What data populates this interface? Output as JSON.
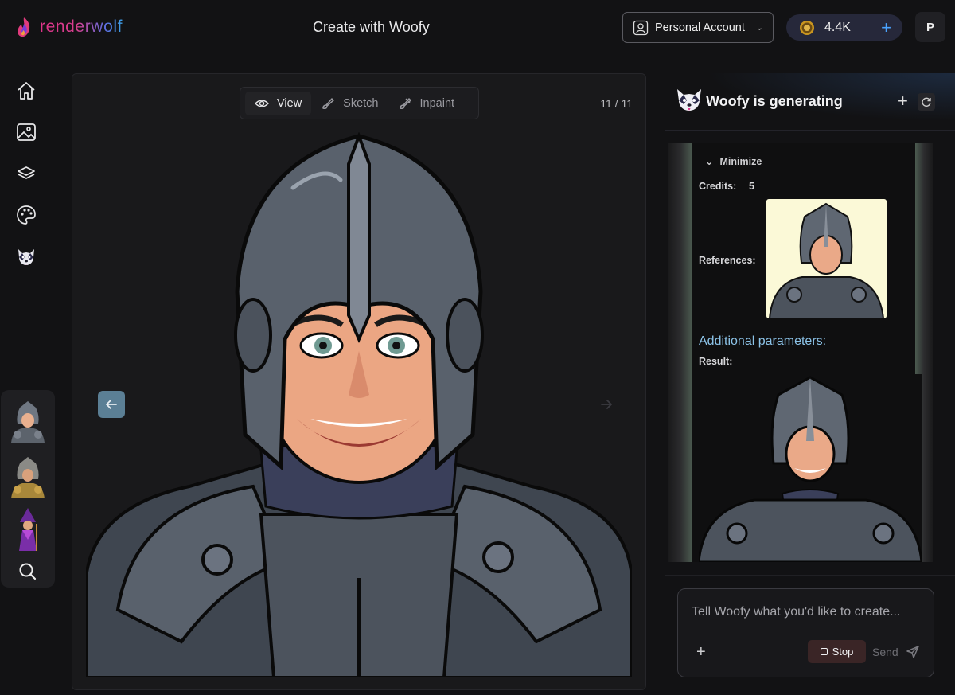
{
  "header": {
    "brand": "renderwolf",
    "title": "Create with Woofy",
    "account_label": "Personal Account",
    "credits": "4.4K",
    "avatar_initial": "P"
  },
  "sidebar": {
    "nav": [
      {
        "name": "home",
        "icon": "home-icon"
      },
      {
        "name": "images",
        "icon": "image-icon"
      },
      {
        "name": "layers",
        "icon": "layers-icon"
      },
      {
        "name": "palette",
        "icon": "palette-icon"
      },
      {
        "name": "woofy",
        "icon": "woofy-icon"
      }
    ],
    "recent_thumbs": [
      "knight-thumb",
      "gold-knight-thumb",
      "wizard-thumb"
    ]
  },
  "canvas": {
    "modes": [
      {
        "label": "View",
        "icon": "eye-icon",
        "active": true
      },
      {
        "label": "Sketch",
        "icon": "brush-icon",
        "active": false
      },
      {
        "label": "Inpaint",
        "icon": "inpaint-brush-icon",
        "active": false
      }
    ],
    "counter": "11 / 11"
  },
  "assistant": {
    "title": "Woofy is generating",
    "minimize_label": "Minimize",
    "credits_label": "Credits:",
    "credits_value": "5",
    "references_label": "References:",
    "additional_params_label": "Additional parameters:",
    "result_label": "Result:",
    "chat_placeholder": "Tell Woofy what you'd like to create...",
    "stop_label": "Stop",
    "send_label": "Send"
  },
  "colors": {
    "accent_blue": "#4aa3ff",
    "link_blue": "#8cc3e8",
    "brand_pink": "#e0338a",
    "stop_bg": "#3a2526"
  }
}
